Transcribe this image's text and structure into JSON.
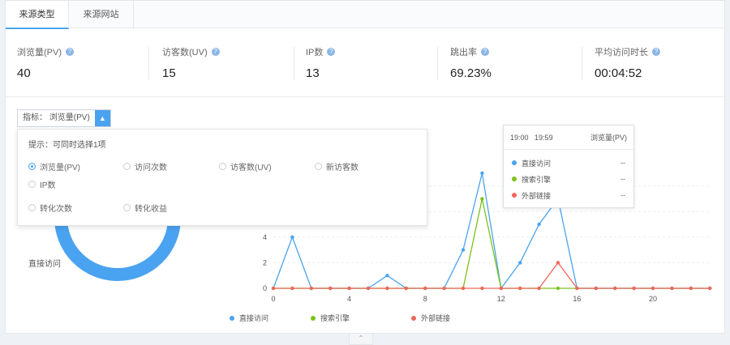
{
  "tabs": [
    {
      "label": "来源类型",
      "active": true
    },
    {
      "label": "来源网站",
      "active": false
    }
  ],
  "metrics": [
    {
      "label": "浏览量(PV)",
      "value": "40"
    },
    {
      "label": "访客数(UV)",
      "value": "15"
    },
    {
      "label": "IP数",
      "value": "13"
    },
    {
      "label": "跳出率",
      "value": "69.23%"
    },
    {
      "label": "平均访问时长",
      "value": "00:04:52"
    }
  ],
  "indicator_selector": {
    "label": "指标： 浏览量(PV)",
    "toggle_icon": "chevron-up-icon"
  },
  "dropdown": {
    "hint": "提示：可同时选择1项",
    "options": [
      "浏览量(PV)",
      "访问次数",
      "访客数(UV)",
      "新访客数",
      "IP数",
      "转化次数",
      "转化收益"
    ],
    "selected": "浏览量(PV)"
  },
  "donut": {
    "label": "直接访问",
    "color": "#4aa3f0"
  },
  "tooltip": {
    "time_start": "19:00",
    "time_end": "19:59",
    "metric": "浏览量(PV)",
    "rows": [
      {
        "name": "直接访问",
        "value": "--",
        "color": "#4aa3f0"
      },
      {
        "name": "搜索引擎",
        "value": "--",
        "color": "#7cc21a"
      },
      {
        "name": "外部链接",
        "value": "--",
        "color": "#f0665a"
      }
    ]
  },
  "chart_data": {
    "type": "line",
    "x": [
      0,
      1,
      2,
      3,
      4,
      5,
      6,
      7,
      8,
      9,
      10,
      11,
      12,
      13,
      14,
      15,
      16,
      17,
      18,
      19,
      20,
      21,
      22,
      23
    ],
    "x_ticks": [
      0,
      4,
      8,
      12,
      16,
      20
    ],
    "y_ticks": [
      0,
      2,
      4
    ],
    "ylim": [
      0,
      10
    ],
    "grid": true,
    "legend_position": "bottom",
    "series": [
      {
        "name": "直接访问",
        "color": "#4aa3f0",
        "values": [
          0,
          4,
          0,
          0,
          0,
          0,
          1,
          0,
          0,
          0,
          3,
          9,
          0,
          2,
          5,
          7,
          0,
          0,
          0,
          0,
          0,
          0,
          0,
          0
        ]
      },
      {
        "name": "搜索引擎",
        "color": "#7cc21a",
        "values": [
          0,
          0,
          0,
          0,
          0,
          0,
          0,
          0,
          0,
          0,
          0,
          7,
          0,
          0,
          0,
          0,
          0,
          0,
          0,
          0,
          0,
          0,
          0,
          0
        ]
      },
      {
        "name": "外部链接",
        "color": "#f0665a",
        "values": [
          0,
          0,
          0,
          0,
          0,
          0,
          0,
          0,
          0,
          0,
          0,
          0,
          0,
          0,
          0,
          2,
          0,
          0,
          0,
          0,
          0,
          0,
          0,
          0
        ]
      }
    ]
  }
}
